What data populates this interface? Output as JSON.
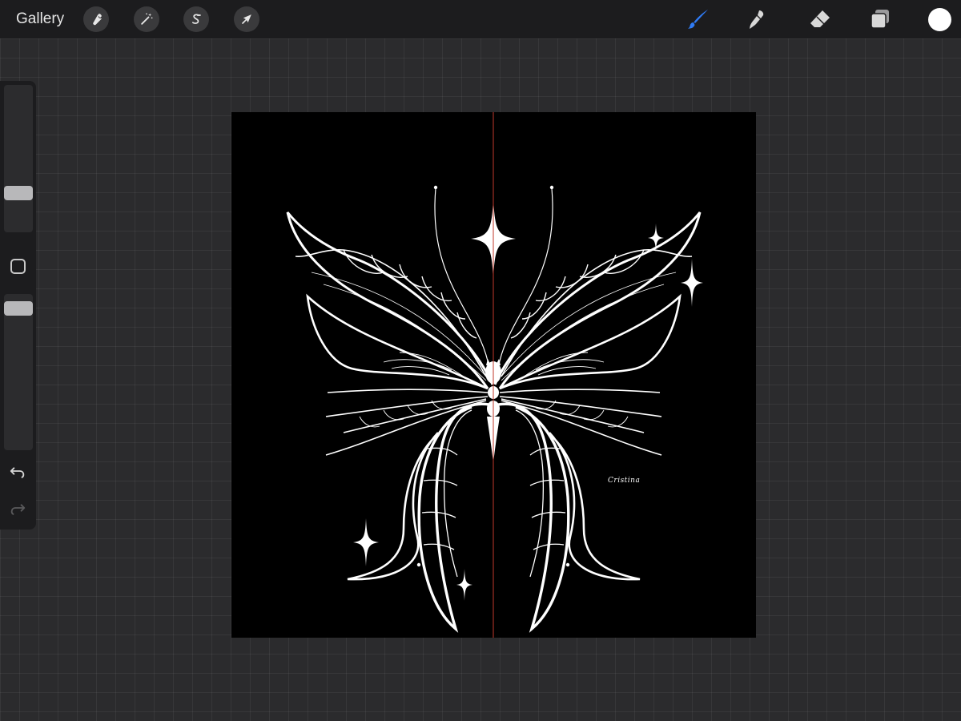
{
  "topbar": {
    "gallery_label": "Gallery",
    "left_tools": [
      {
        "name": "actions",
        "icon": "wrench-icon"
      },
      {
        "name": "adjustments",
        "icon": "magic-wand-icon"
      },
      {
        "name": "selection",
        "icon": "selection-s-icon"
      },
      {
        "name": "transform",
        "icon": "arrow-cursor-icon"
      }
    ],
    "right_tools": [
      {
        "name": "brush",
        "icon": "brush-icon",
        "active": true
      },
      {
        "name": "smudge",
        "icon": "smudge-icon",
        "active": false
      },
      {
        "name": "eraser",
        "icon": "eraser-icon",
        "active": false
      },
      {
        "name": "layers",
        "icon": "layers-icon",
        "active": false
      }
    ],
    "active_color": "#ffffff",
    "accent_color": "#2f7bf5"
  },
  "sidebar": {
    "brush_size_level": 0.24,
    "opacity_level": 0.95,
    "modify_icon": "square-icon",
    "undo_icon": "undo-icon",
    "redo_icon": "redo-icon"
  },
  "canvas": {
    "background": "#000000",
    "artwork": "butterfly-line-art",
    "symmetry_guide_color": "#c0392b",
    "signature": "Cristina"
  }
}
